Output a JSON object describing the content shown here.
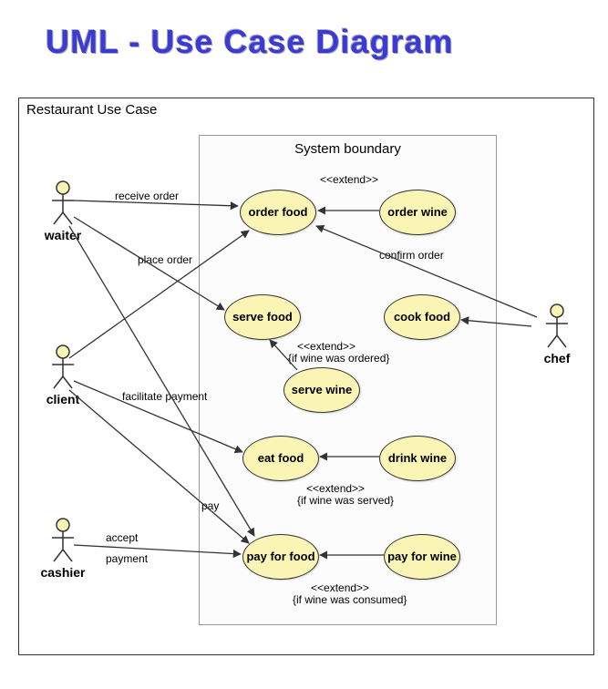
{
  "title": "UML - Use Case Diagram",
  "frame_title": "Restaurant Use Case",
  "boundary_title": "System boundary",
  "actors": {
    "waiter": "waiter",
    "client": "client",
    "cashier": "cashier",
    "chef": "chef"
  },
  "usecases": {
    "order_food": "order food",
    "order_wine": "order wine",
    "serve_food": "serve food",
    "cook_food": "cook food",
    "serve_wine": "serve wine",
    "eat_food": "eat food",
    "drink_wine": "drink wine",
    "pay_for_food": "pay for food",
    "pay_for_wine": "pay for wine"
  },
  "labels": {
    "receive_order": "receive order",
    "place_order": "place order",
    "confirm_order": "confirm order",
    "facilitate_payment": "facilitate payment",
    "pay": "pay",
    "accept": "accept",
    "payment": "payment",
    "extend1": "<<extend>>",
    "extend2": "<<extend>>",
    "extend2_cond": "{if wine was ordered}",
    "extend3": "<<extend>>",
    "extend3_cond": "{if wine was served}",
    "extend4": "<<extend>>",
    "extend4_cond": "{if wine was consumed}"
  }
}
